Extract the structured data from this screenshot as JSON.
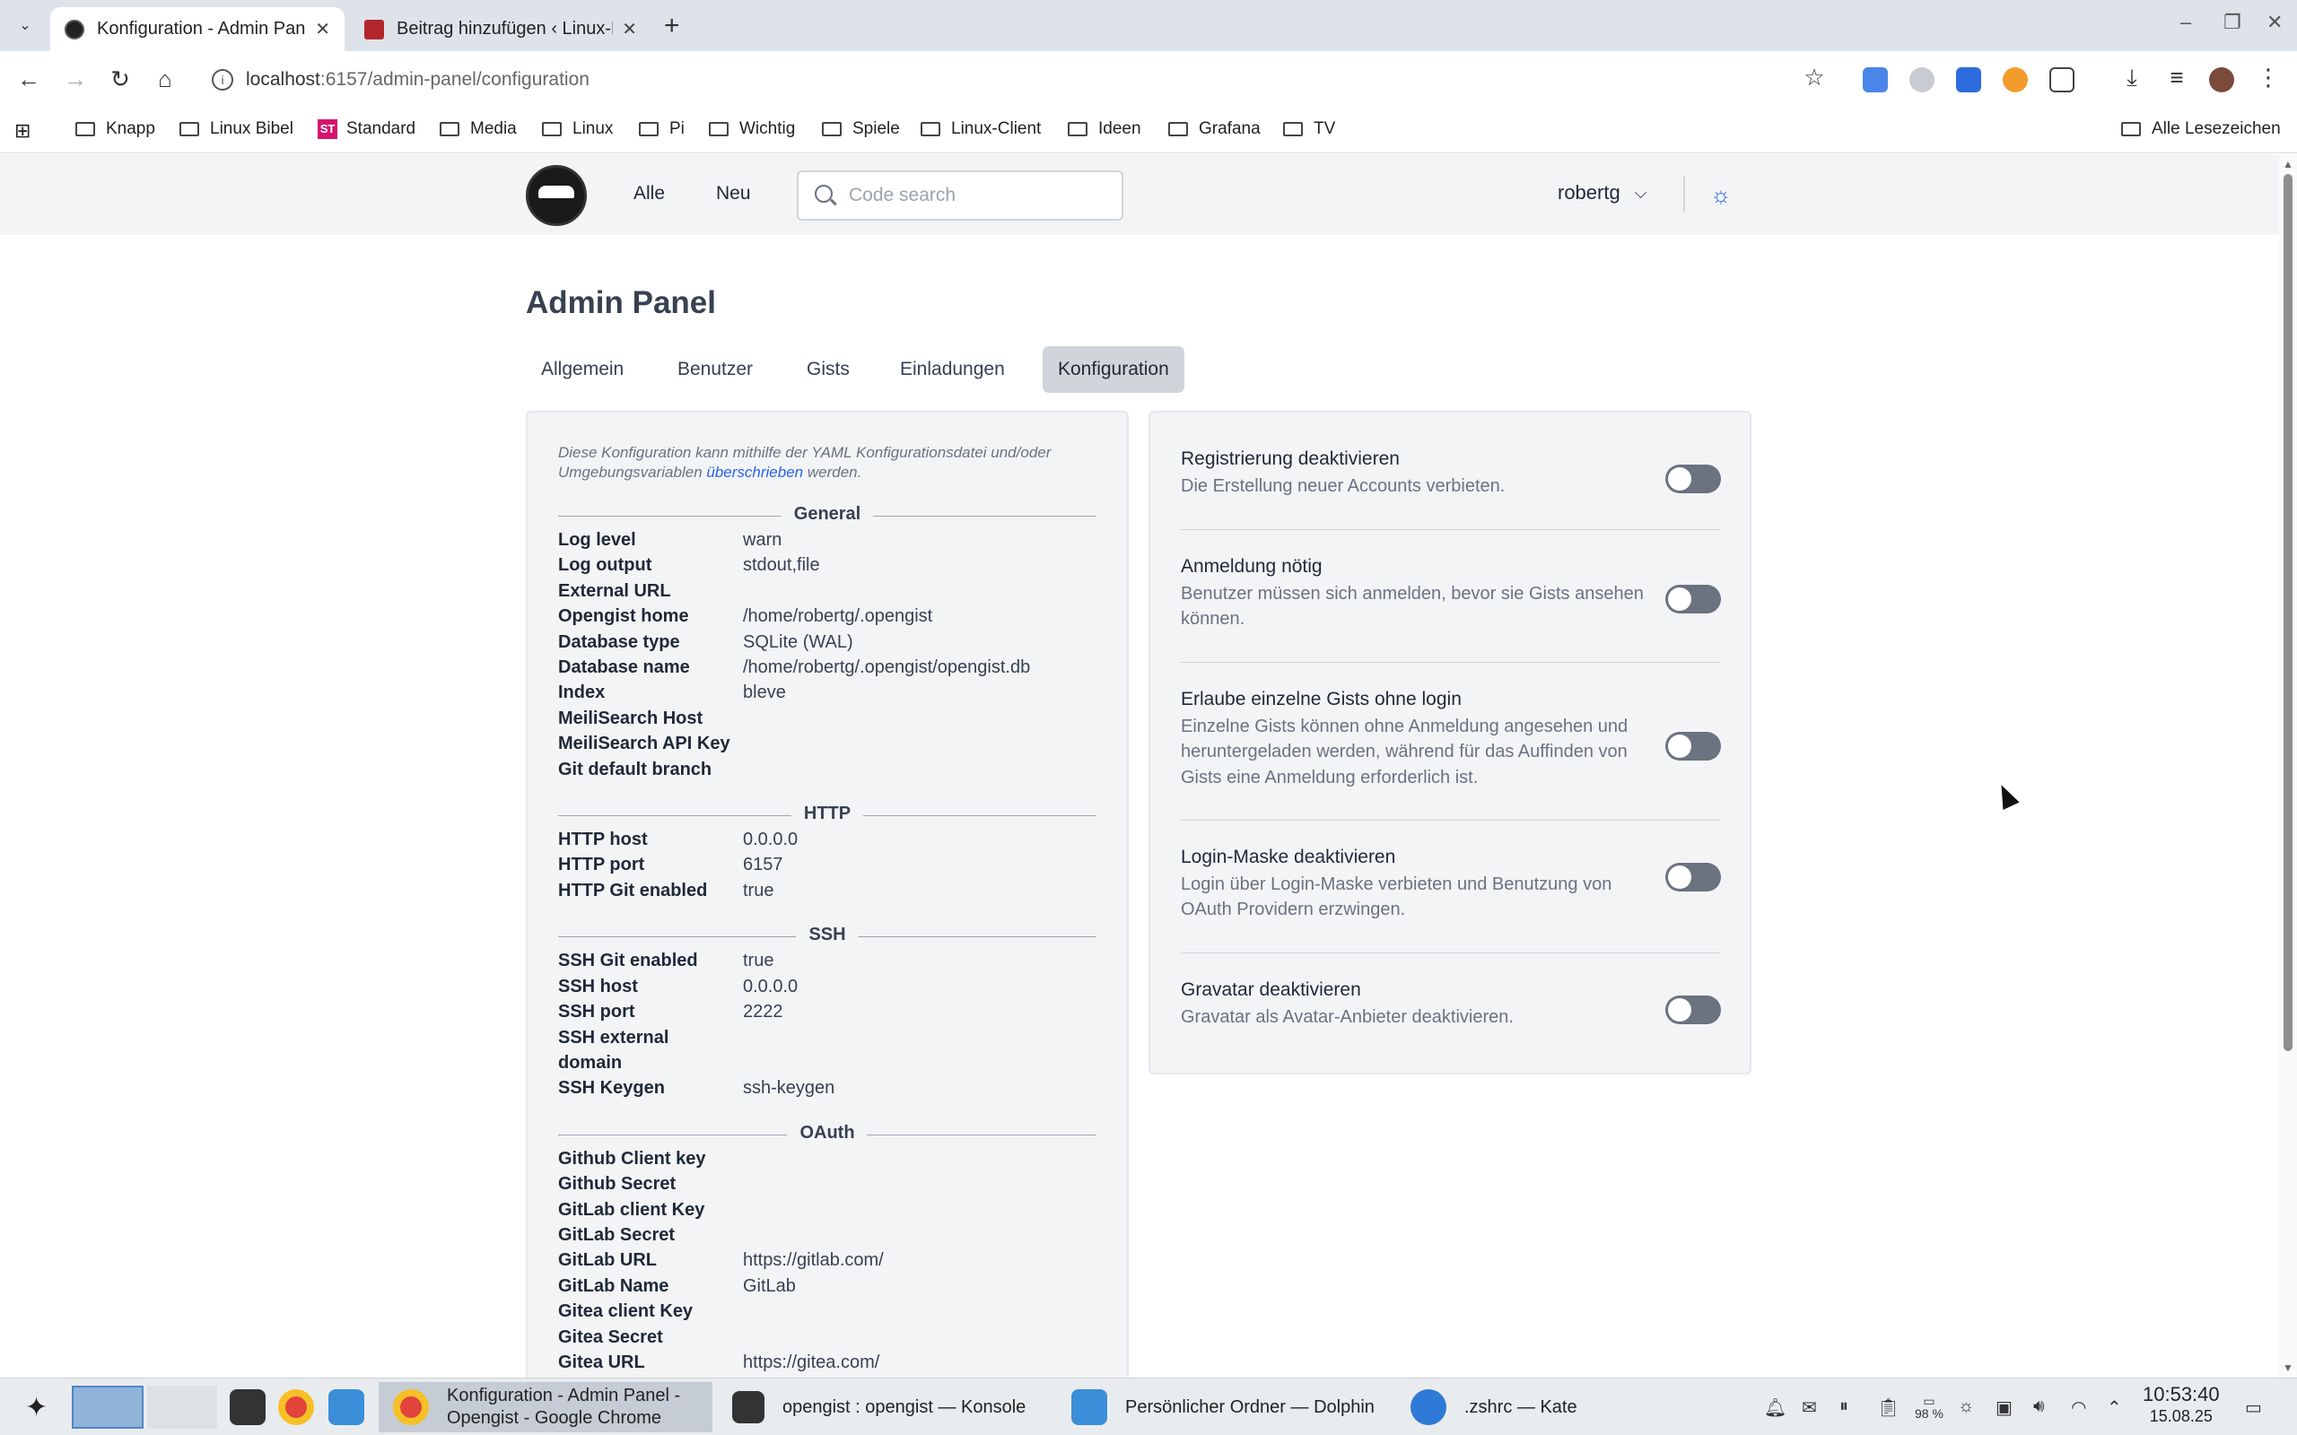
{
  "browser": {
    "tabs": [
      {
        "title": "Konfiguration - Admin Panel - Opengist",
        "active": true
      },
      {
        "title": "Beitrag hinzufügen ‹ Linux-Bibel",
        "active": false
      }
    ],
    "url_host": "localhost",
    "url_rest": ":6157/admin-panel/configuration",
    "bookmarks": [
      "Knapp",
      "Linux Bibel",
      "Standard",
      "Media",
      "Linux",
      "Pi",
      "Wichtig",
      "Spiele",
      "Linux-Client",
      "Ideen",
      "Grafana",
      "TV"
    ],
    "all_bookmarks": "Alle Lesezeichen",
    "standard_badge": "ST"
  },
  "header": {
    "nav_all": "Alle",
    "nav_new": "Neu",
    "search_placeholder": "Code search",
    "username": "robertg"
  },
  "page": {
    "title": "Admin Panel",
    "tabs": [
      "Allgemein",
      "Benutzer",
      "Gists",
      "Einladungen",
      "Konfiguration"
    ],
    "active_tab": "Konfiguration"
  },
  "config": {
    "note_prefix": "Diese Konfiguration kann mithilfe der YAML Konfigurationsdatei und/oder Umgebungsvariablen ",
    "note_link": "überschrieben",
    "note_suffix": " werden.",
    "sections": [
      {
        "name": "General",
        "rows": [
          {
            "k": "Log level",
            "v": "warn"
          },
          {
            "k": "Log output",
            "v": "stdout,file"
          },
          {
            "k": "External URL",
            "v": ""
          },
          {
            "k": "Opengist home",
            "v": "/home/robertg/.opengist"
          },
          {
            "k": "Database type",
            "v": "SQLite (WAL)"
          },
          {
            "k": "Database name",
            "v": "/home/robertg/.opengist/opengist.db"
          },
          {
            "k": "Index",
            "v": "bleve"
          },
          {
            "k": "MeiliSearch Host",
            "v": ""
          },
          {
            "k": "MeiliSearch API Key",
            "v": ""
          },
          {
            "k": "Git default branch",
            "v": ""
          }
        ]
      },
      {
        "name": "HTTP",
        "rows": [
          {
            "k": "HTTP host",
            "v": "0.0.0.0"
          },
          {
            "k": "HTTP port",
            "v": "6157"
          },
          {
            "k": "HTTP Git enabled",
            "v": "true"
          }
        ]
      },
      {
        "name": "SSH",
        "rows": [
          {
            "k": "SSH Git enabled",
            "v": "true"
          },
          {
            "k": "SSH host",
            "v": "0.0.0.0"
          },
          {
            "k": "SSH port",
            "v": "2222"
          },
          {
            "k": "SSH external",
            "v": ""
          },
          {
            "k": "domain",
            "v": ""
          },
          {
            "k": "SSH Keygen",
            "v": "ssh-keygen"
          }
        ]
      },
      {
        "name": "OAuth",
        "rows": [
          {
            "k": "Github Client key",
            "v": ""
          },
          {
            "k": "Github Secret",
            "v": ""
          },
          {
            "k": "GitLab client Key",
            "v": ""
          },
          {
            "k": "GitLab Secret",
            "v": ""
          },
          {
            "k": "GitLab URL",
            "v": "https://gitlab.com/"
          },
          {
            "k": "GitLab Name",
            "v": "GitLab"
          },
          {
            "k": "Gitea client Key",
            "v": ""
          },
          {
            "k": "Gitea Secret",
            "v": ""
          },
          {
            "k": "Gitea URL",
            "v": "https://gitea.com/"
          }
        ]
      }
    ]
  },
  "settings": [
    {
      "title": "Registrierung deaktivieren",
      "desc": "Die Erstellung neuer Accounts verbieten.",
      "enabled": false
    },
    {
      "title": "Anmeldung nötig",
      "desc": "Benutzer müssen sich anmelden, bevor sie Gists ansehen können.",
      "enabled": false
    },
    {
      "title": "Erlaube einzelne Gists ohne login",
      "desc": "Einzelne Gists können ohne Anmeldung angesehen und heruntergeladen werden, während für das Auffinden von Gists eine Anmeldung erforderlich ist.",
      "enabled": false
    },
    {
      "title": "Login-Maske deaktivieren",
      "desc": "Login über Login-Maske verbieten und Benutzung von OAuth Providern erzwingen.",
      "enabled": false
    },
    {
      "title": "Gravatar deaktivieren",
      "desc": "Gravatar als Avatar-Anbieter deaktivieren.",
      "enabled": false
    }
  ],
  "taskbar": {
    "tasks": [
      {
        "line1": "Konfiguration - Admin Panel -",
        "line2": "Opengist - Google Chrome"
      },
      {
        "line1": "opengist : opengist — Konsole",
        "line2": ""
      },
      {
        "line1": "Persönlicher Ordner — Dolphin",
        "line2": ""
      },
      {
        "line1": ".zshrc — Kate",
        "line2": ""
      }
    ],
    "time": "10:53:40",
    "date": "15.08.25",
    "battery": "98 %"
  }
}
